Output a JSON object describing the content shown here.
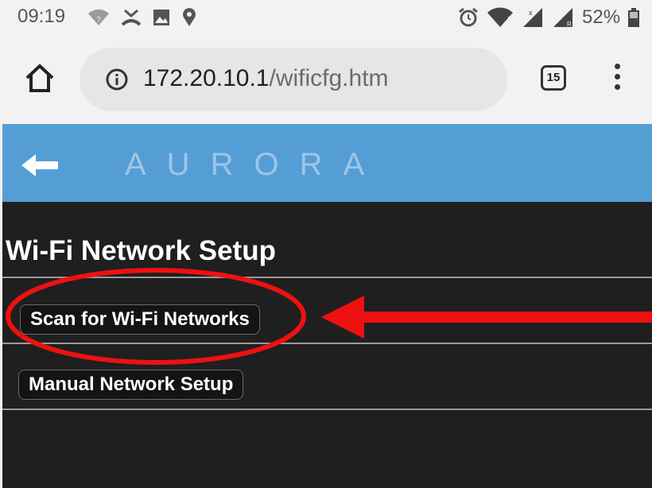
{
  "status_bar": {
    "time": "09:19",
    "battery_percent": "52%",
    "icons_left": [
      "wifi-question-icon",
      "missed-call-icon",
      "image-icon",
      "location-pin-icon"
    ],
    "icons_right": [
      "alarm-clock-icon",
      "wifi-alert-icon",
      "cell-signal-icon",
      "cell-signal-roaming-icon",
      "battery-icon"
    ]
  },
  "browser": {
    "url_host": "172.20.10.1",
    "url_path": "/wificfg.htm",
    "tab_count": "15"
  },
  "header": {
    "brand": "AURORA",
    "accent_color": "#559dd5"
  },
  "page": {
    "title": "Wi-Fi Network Setup",
    "buttons": [
      {
        "label": "Scan for Wi-Fi Networks"
      },
      {
        "label": "Manual Network Setup"
      }
    ]
  },
  "annotation": {
    "color": "#ee1111"
  }
}
